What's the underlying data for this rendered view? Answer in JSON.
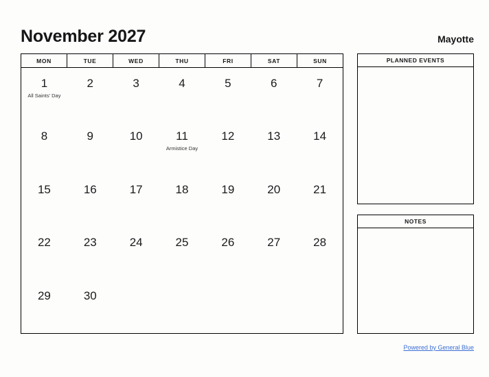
{
  "header": {
    "month_title": "November 2027",
    "region": "Mayotte"
  },
  "calendar": {
    "day_headers": [
      "MON",
      "TUE",
      "WED",
      "THU",
      "FRI",
      "SAT",
      "SUN"
    ],
    "weeks": [
      [
        {
          "day": "1",
          "event": "All Saints' Day"
        },
        {
          "day": "2",
          "event": ""
        },
        {
          "day": "3",
          "event": ""
        },
        {
          "day": "4",
          "event": ""
        },
        {
          "day": "5",
          "event": ""
        },
        {
          "day": "6",
          "event": ""
        },
        {
          "day": "7",
          "event": ""
        }
      ],
      [
        {
          "day": "8",
          "event": ""
        },
        {
          "day": "9",
          "event": ""
        },
        {
          "day": "10",
          "event": ""
        },
        {
          "day": "11",
          "event": "Armistice Day"
        },
        {
          "day": "12",
          "event": ""
        },
        {
          "day": "13",
          "event": ""
        },
        {
          "day": "14",
          "event": ""
        }
      ],
      [
        {
          "day": "15",
          "event": ""
        },
        {
          "day": "16",
          "event": ""
        },
        {
          "day": "17",
          "event": ""
        },
        {
          "day": "18",
          "event": ""
        },
        {
          "day": "19",
          "event": ""
        },
        {
          "day": "20",
          "event": ""
        },
        {
          "day": "21",
          "event": ""
        }
      ],
      [
        {
          "day": "22",
          "event": ""
        },
        {
          "day": "23",
          "event": ""
        },
        {
          "day": "24",
          "event": ""
        },
        {
          "day": "25",
          "event": ""
        },
        {
          "day": "26",
          "event": ""
        },
        {
          "day": "27",
          "event": ""
        },
        {
          "day": "28",
          "event": ""
        }
      ],
      [
        {
          "day": "29",
          "event": ""
        },
        {
          "day": "30",
          "event": ""
        },
        {
          "day": "",
          "event": ""
        },
        {
          "day": "",
          "event": ""
        },
        {
          "day": "",
          "event": ""
        },
        {
          "day": "",
          "event": ""
        },
        {
          "day": "",
          "event": ""
        }
      ]
    ]
  },
  "panels": {
    "planned_events": {
      "title": "PLANNED EVENTS",
      "content": ""
    },
    "notes": {
      "title": "NOTES",
      "content": ""
    }
  },
  "footer": {
    "link_label": "Powered by General Blue"
  },
  "colors": {
    "link": "#3b6fd4",
    "border": "#000000",
    "background": "#fdfdfc",
    "text": "#1a1a1a"
  }
}
